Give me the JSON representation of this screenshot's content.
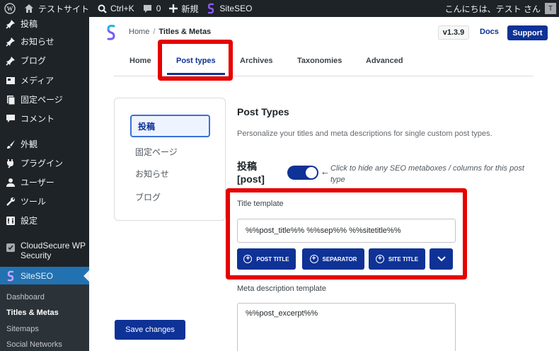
{
  "admin_bar": {
    "site_name": "テストサイト",
    "shortcut": "Ctrl+K",
    "comments_count": "0",
    "new_label": "新規",
    "plugin_label": "SiteSEO",
    "greeting": "こんにちは、テスト さん",
    "avatar_letter": "T"
  },
  "sidebar": {
    "items": [
      {
        "label": "投稿",
        "icon": "pin-icon"
      },
      {
        "label": "お知らせ",
        "icon": "pin-icon"
      },
      {
        "label": "ブログ",
        "icon": "pin-icon"
      },
      {
        "label": "メディア",
        "icon": "media-icon"
      },
      {
        "label": "固定ページ",
        "icon": "page-icon"
      },
      {
        "label": "コメント",
        "icon": "comment-icon"
      },
      {
        "label": "外観",
        "icon": "brush-icon"
      },
      {
        "label": "プラグイン",
        "icon": "plugin-icon"
      },
      {
        "label": "ユーザー",
        "icon": "user-icon"
      },
      {
        "label": "ツール",
        "icon": "wrench-icon"
      },
      {
        "label": "設定",
        "icon": "settings-icon"
      },
      {
        "label": "CloudSecure WP Security",
        "icon": "shield-icon"
      },
      {
        "label": "SiteSEO",
        "icon": "siteseo-icon"
      }
    ],
    "submenu": [
      "Dashboard",
      "Titles & Metas",
      "Sitemaps",
      "Social Networks"
    ]
  },
  "header": {
    "breadcrumb_home": "Home",
    "breadcrumb_sep": "/",
    "breadcrumb_current": "Titles & Metas",
    "version": "v1.3.9",
    "docs": "Docs",
    "support": "Support"
  },
  "tabs": [
    "Home",
    "Post types",
    "Archives",
    "Taxonomies",
    "Advanced"
  ],
  "active_tab": "Post types",
  "post_nav": {
    "items": [
      "投稿",
      "固定ページ",
      "お知らせ",
      "ブログ"
    ],
    "active": "投稿"
  },
  "main": {
    "heading": "Post Types",
    "description": "Personalize your titles and meta descriptions for single custom post types.",
    "post_type_name": "投稿",
    "post_type_slug": "[post]",
    "toggle_on": true,
    "toggle_arrow": "←",
    "toggle_hint": "Click to hide any SEO metaboxes / columns for this post type",
    "title_label": "Title template",
    "title_value": "%%post_title%% %%sep%% %%sitetitle%%",
    "tag_buttons": [
      "POST TITLE",
      "SEPARATOR",
      "SITE TITLE"
    ],
    "meta_label": "Meta description template",
    "meta_value": "%%post_excerpt%%",
    "save_label": "Save changes"
  },
  "colors": {
    "accent": "#0e3296",
    "highlight": "#e60000",
    "wp_sidebar": "#1d2327",
    "wp_active": "#2271b1"
  }
}
